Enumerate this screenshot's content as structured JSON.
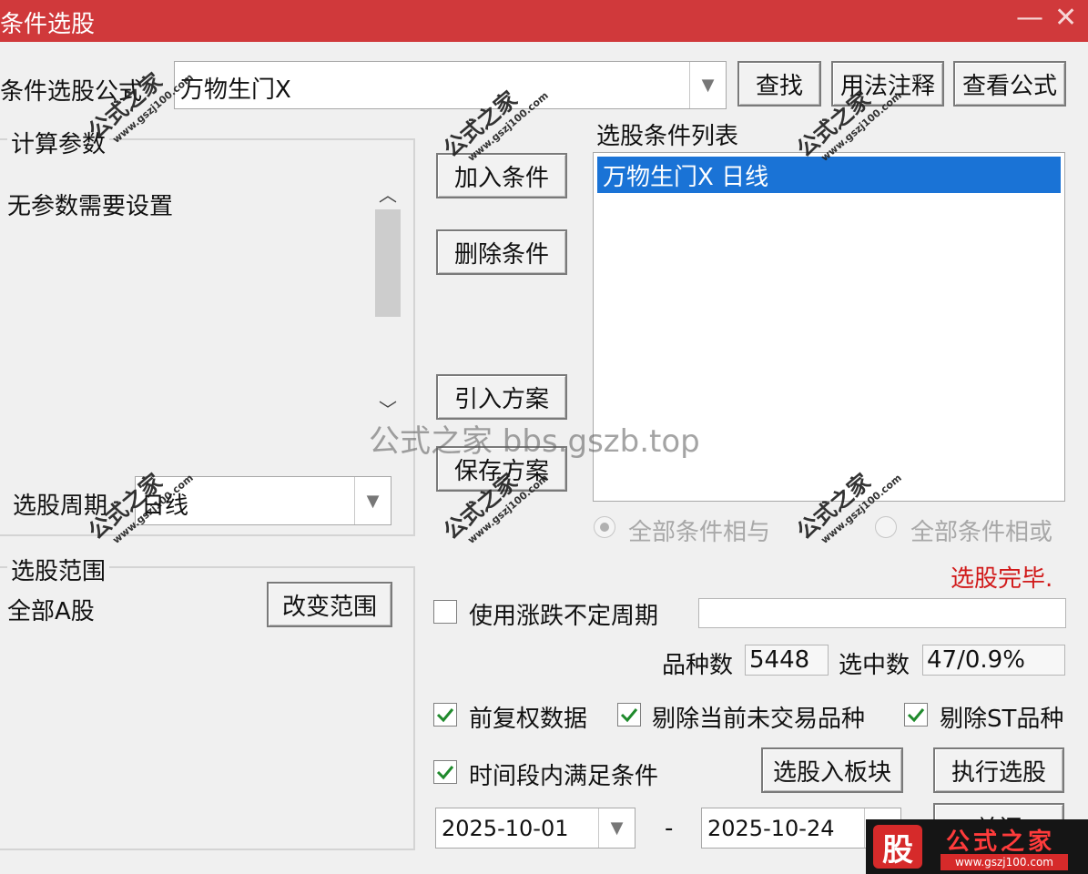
{
  "window": {
    "title": "条件选股",
    "minimize_glyph": "—",
    "close_glyph": "✕"
  },
  "formula": {
    "label": "条件选股公式",
    "value": "万物生门X",
    "find_button": "查找",
    "notes_button": "用法注释",
    "view_button": "查看公式"
  },
  "params": {
    "group_title": "计算参数",
    "message": "无参数需要设置"
  },
  "period": {
    "label": "选股周期",
    "value": "日线"
  },
  "scope": {
    "group_title": "选股范围",
    "value": "全部A股",
    "change_button": "改变范围"
  },
  "actions": {
    "add": "加入条件",
    "delete": "删除条件",
    "import": "引入方案",
    "save": "保存方案"
  },
  "conditions": {
    "title": "选股条件列表",
    "items": [
      "万物生门X  日线"
    ]
  },
  "logic": {
    "and_label": "全部条件相与",
    "or_label": "全部条件相或",
    "selected": "and"
  },
  "status": {
    "text": "选股完毕.",
    "color": "#d11a1a"
  },
  "irregular": {
    "label": "使用涨跌不定周期",
    "checked": false,
    "value": ""
  },
  "counts": {
    "total_label": "品种数",
    "total_value": "5448",
    "picked_label": "选中数",
    "picked_value": "47/0.9%"
  },
  "options": {
    "adjust": {
      "label": "前复权数据",
      "checked": true
    },
    "exclude_untraded": {
      "label": "剔除当前未交易品种",
      "checked": true
    },
    "exclude_st": {
      "label": "剔除ST品种",
      "checked": true
    },
    "in_period": {
      "label": "时间段内满足条件",
      "checked": true
    }
  },
  "buttons": {
    "to_block": "选股入板块",
    "execute": "执行选股",
    "close": "关闭"
  },
  "dates": {
    "start": "2025-10-01",
    "separator": "-",
    "end": "2025-10-24"
  },
  "watermarks": {
    "text": "公式之家",
    "url": "www.gszj100.com",
    "center": "公式之家 bbs.gszb.top",
    "brand_glyph": "股",
    "brand_name": "公式之家",
    "brand_url": "www.gszj100.com"
  },
  "colors": {
    "titlebar": "#d0393b",
    "selection": "#1a73d6",
    "check": "#1f8a2c"
  },
  "icons": {
    "checked": "check-mark-icon",
    "dropdown": "chevron-down-icon",
    "scroll_up": "chevron-up-icon",
    "scroll_down": "chevron-down-icon"
  }
}
